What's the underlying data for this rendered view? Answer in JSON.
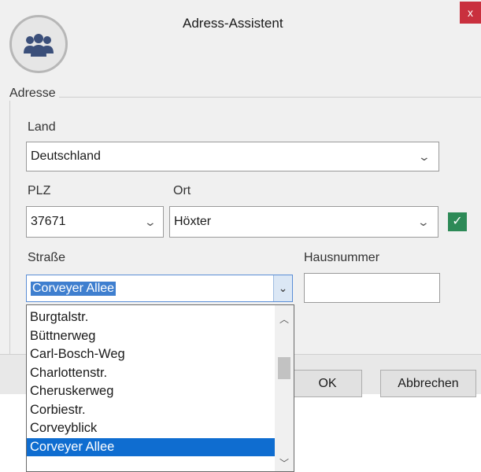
{
  "window": {
    "title": "Adress-Assistent",
    "close_label": "x"
  },
  "group": {
    "label": "Adresse"
  },
  "land": {
    "label": "Land",
    "value": "Deutschland"
  },
  "plz": {
    "label": "PLZ",
    "value": "37671"
  },
  "ort": {
    "label": "Ort",
    "value": "Höxter"
  },
  "strasse": {
    "label": "Straße",
    "value": "Corveyer Allee",
    "options": [
      "Burgtalstr.",
      "Büttnerweg",
      "Carl-Bosch-Weg",
      "Charlottenstr.",
      "Cheruskerweg",
      "Corbiestr.",
      "Corveyblick",
      "Corveyer Allee"
    ],
    "selected_option": "Corveyer Allee"
  },
  "hausnummer": {
    "label": "Hausnummer",
    "value": ""
  },
  "buttons": {
    "ok": "OK",
    "cancel": "Abbrechen"
  },
  "icons": {
    "logo": "people-group-icon",
    "dropdown": "chevron-down-icon",
    "valid": "checkmark-icon",
    "scroll_up": "chevron-up-icon",
    "scroll_down": "chevron-down-icon"
  },
  "colors": {
    "accent": "#0f6dd0",
    "close": "#c9303e",
    "valid": "#2d8a57",
    "logo_fill": "#3b4f7a"
  }
}
